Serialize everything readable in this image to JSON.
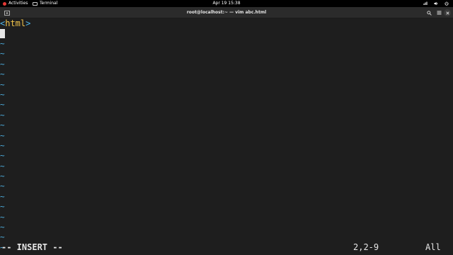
{
  "topbar": {
    "activities_label": "Activities",
    "app_label": "Terminal",
    "clock": "Apr 19  15:38",
    "status_icons": [
      "network-icon",
      "volume-icon",
      "power-icon"
    ]
  },
  "window": {
    "title": "root@localhost:~ — vim abc.html",
    "buttons": [
      "new-tab-icon",
      "search-icon",
      "hamburger-menu-icon",
      "close-icon"
    ]
  },
  "editor": {
    "lines": [
      {
        "open": "<",
        "name": "html",
        "close": ">"
      }
    ],
    "tilde_char": "~",
    "tilde_count": 21,
    "colors": {
      "background": "#1e1e1e",
      "tag_bracket": "#4fb6ea",
      "tag_name": "#f0c34a",
      "tilde": "#4fb6ea"
    }
  },
  "statusline": {
    "mode": "-- INSERT --",
    "position": "2,2-9",
    "scroll": "All"
  }
}
